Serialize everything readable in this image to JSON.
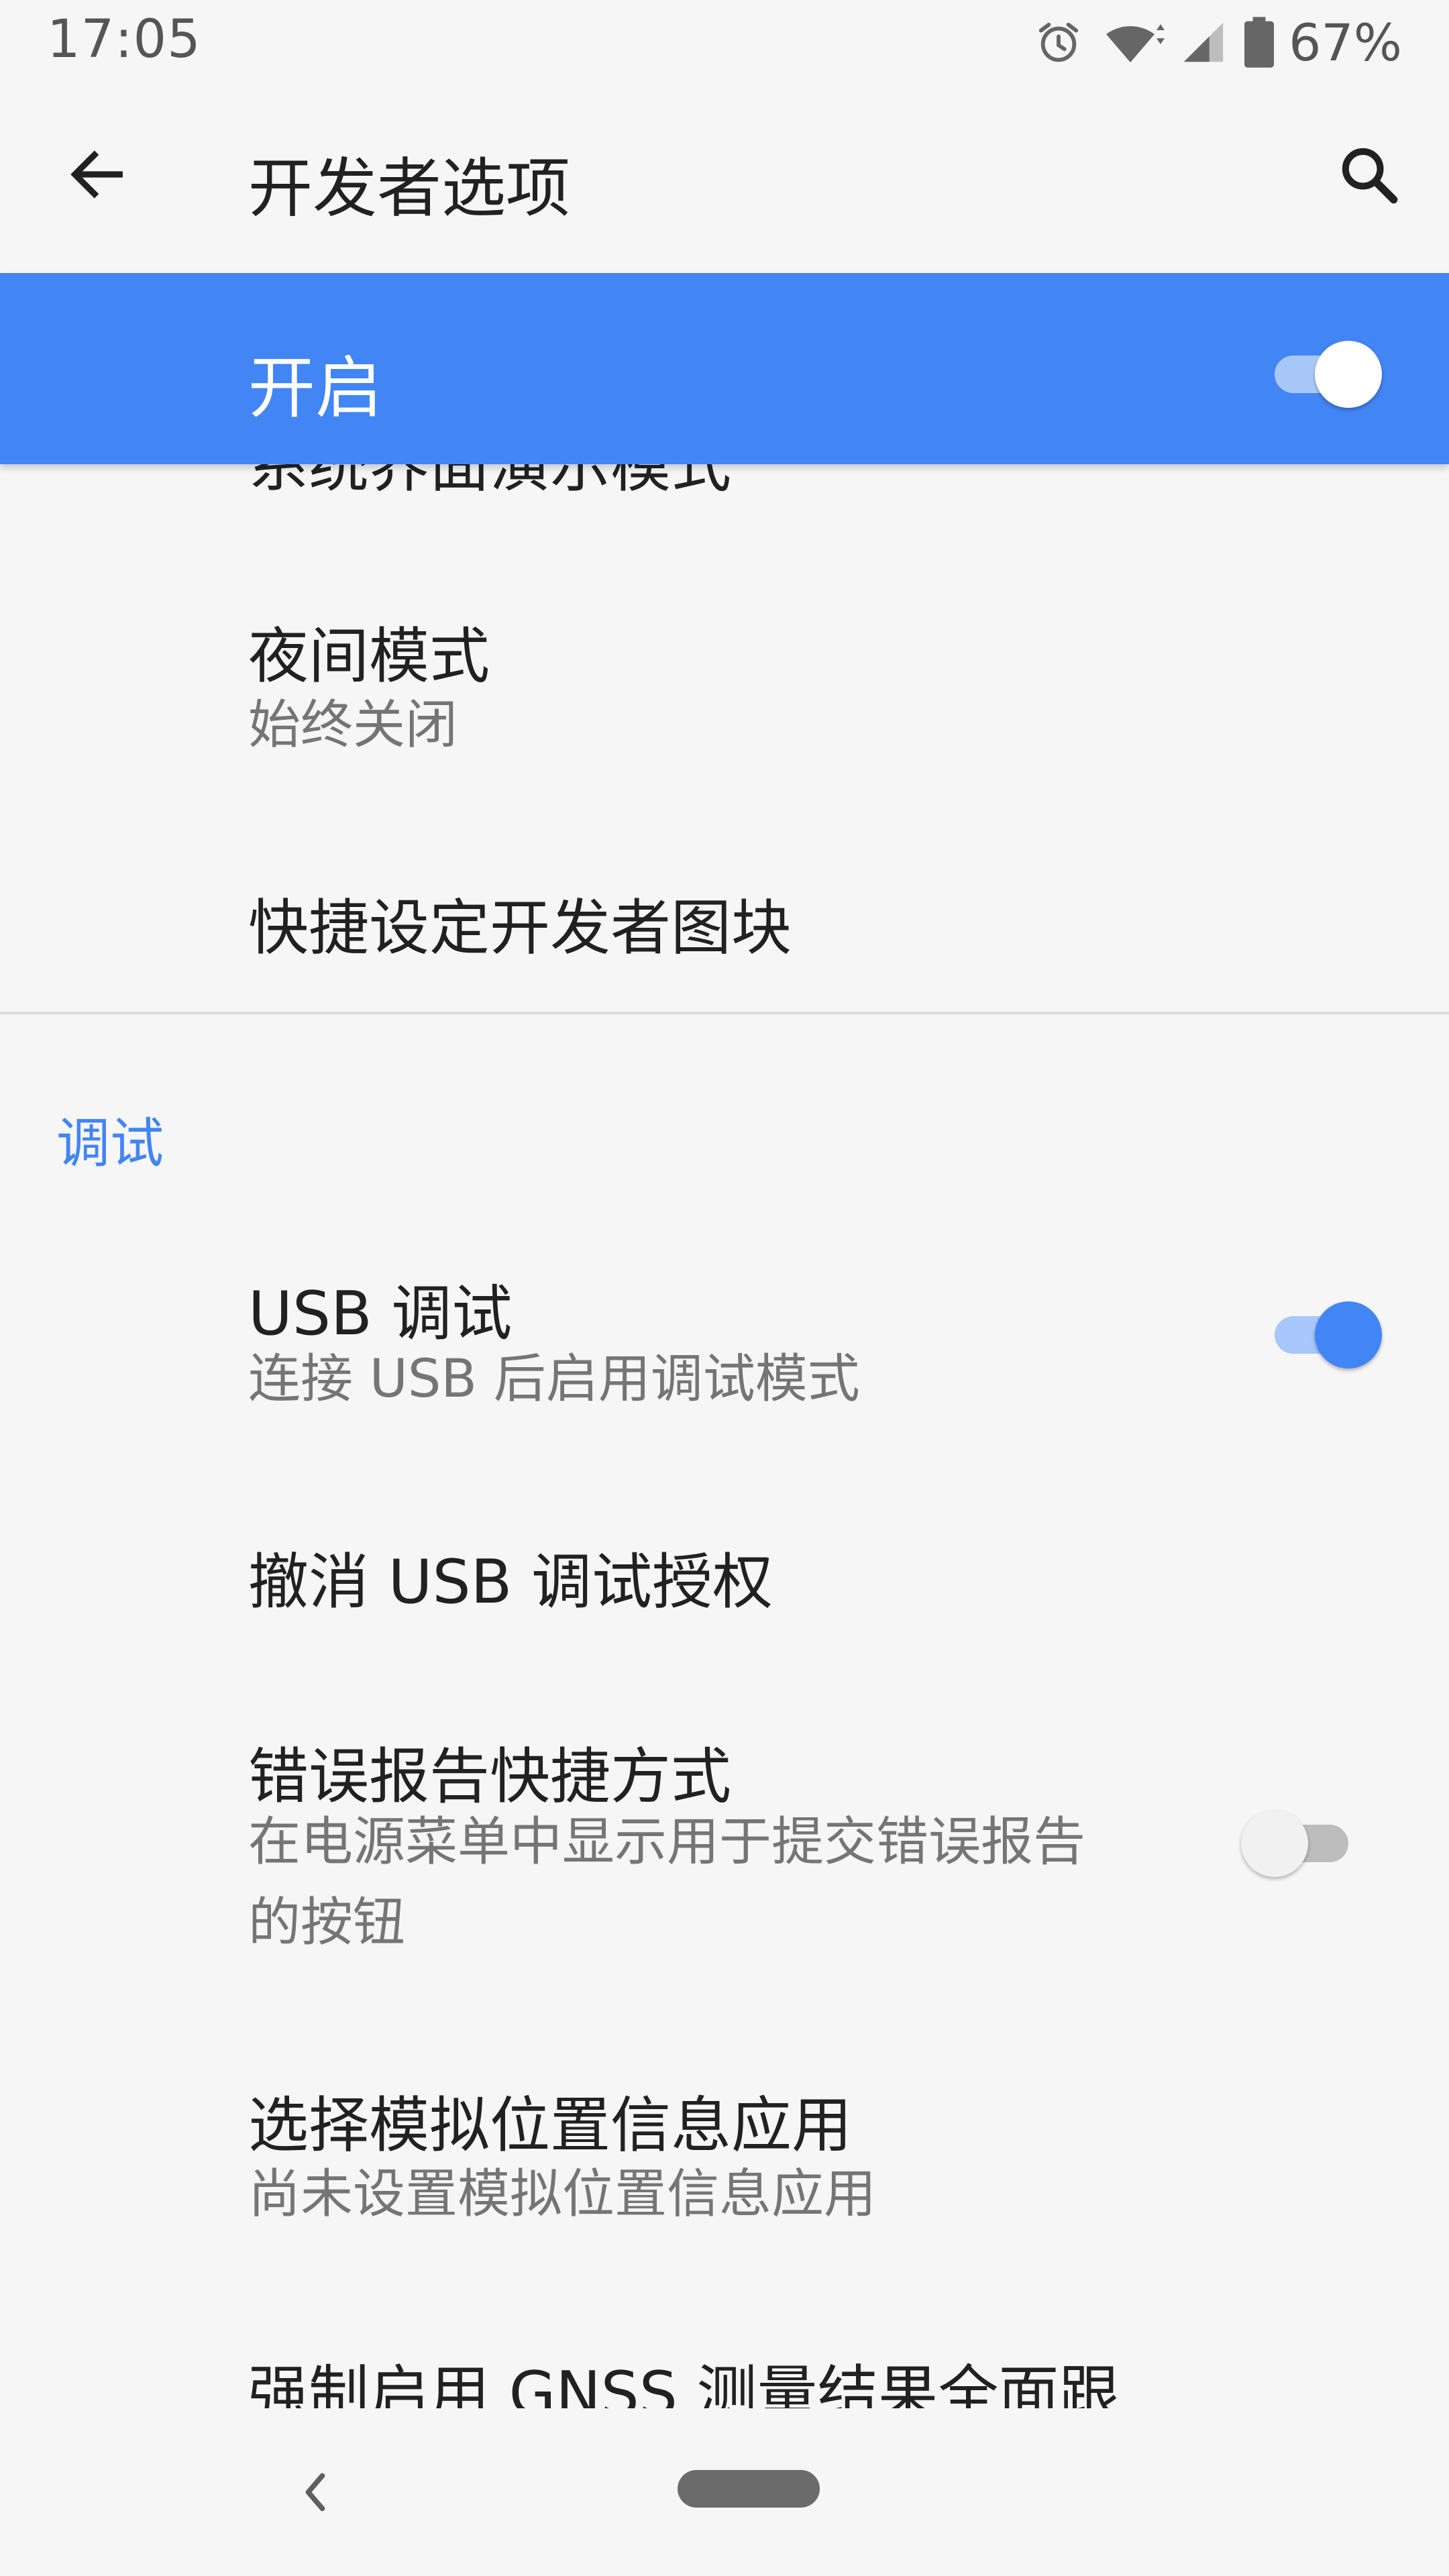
{
  "status_bar": {
    "time": "17:05",
    "battery_percent": "67%",
    "icons": [
      "alarm-icon",
      "wifi-icon",
      "signal-icon",
      "battery-icon"
    ]
  },
  "app_bar": {
    "title": "开发者选项",
    "back_icon": "arrow-back-icon",
    "search_icon": "search-icon"
  },
  "master_switch": {
    "label": "开启",
    "state": "on"
  },
  "settings": {
    "partial_item_title": "系统界面演示模式",
    "night_mode": {
      "title": "夜间模式",
      "subtitle": "始终关闭"
    },
    "quick_tiles": {
      "title": "快捷设定开发者图块"
    },
    "debug_category": "调试",
    "usb_debugging": {
      "title": "USB 调试",
      "subtitle": "连接 USB 后启用调试模式",
      "state": "on"
    },
    "revoke_usb": {
      "title": "撤消 USB 调试授权"
    },
    "bug_report": {
      "title": "错误报告快捷方式",
      "subtitle_line1": "在电源菜单中显示用于提交错误报告",
      "subtitle_line2": "的按钮",
      "state": "off"
    },
    "mock_location": {
      "title": "选择模拟位置信息应用",
      "subtitle": "尚未设置模拟位置信息应用"
    },
    "gnss": {
      "title": "强制启用 GNSS 测量结果全面跟"
    }
  },
  "colors": {
    "accent": "#4285f4",
    "background": "#f6f6f6",
    "primary_text": "#212121",
    "secondary_text": "#757575"
  }
}
